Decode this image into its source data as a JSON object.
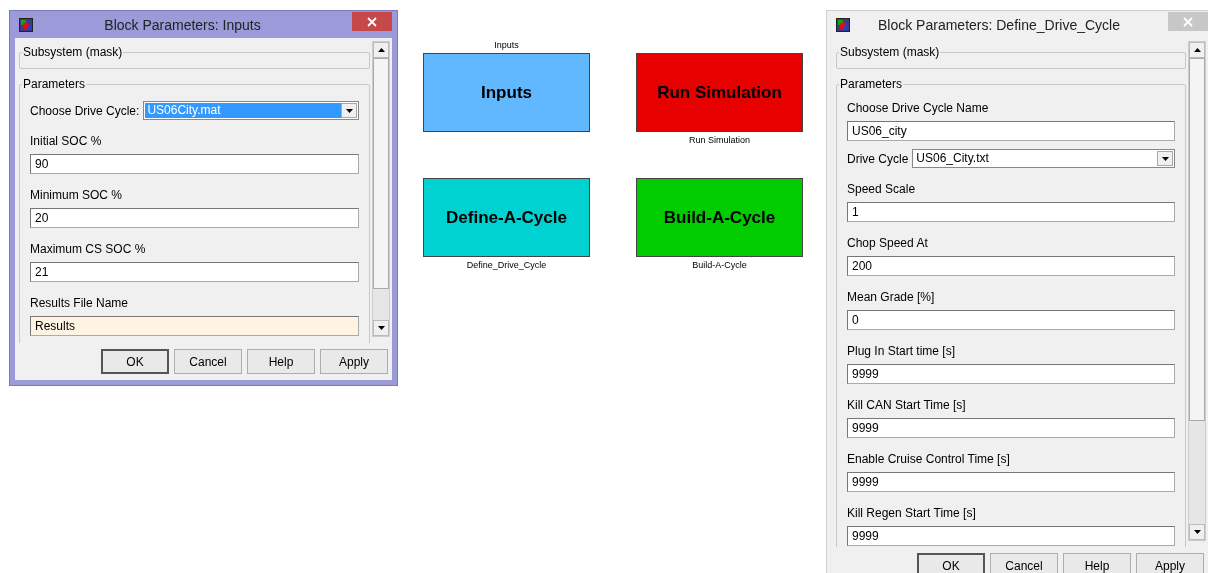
{
  "dialogs": [
    {
      "title": "Block Parameters: Inputs",
      "active": true,
      "group_1": "Subsystem (mask)",
      "group_2": "Parameters",
      "params": [
        {
          "kind": "select-inline",
          "label": "Choose Drive Cycle:",
          "value": "US06City.mat",
          "focused": true
        },
        {
          "kind": "text",
          "label": "Initial SOC %",
          "value": "90",
          "highlighted": false
        },
        {
          "kind": "text",
          "label": "Minimum SOC %",
          "value": "20",
          "highlighted": false
        },
        {
          "kind": "text",
          "label": "Maximum CS SOC %",
          "value": "21",
          "highlighted": false
        },
        {
          "kind": "text",
          "label": "Results File Name",
          "value": "Results",
          "highlighted": true
        }
      ],
      "buttons": [
        {
          "label": "OK",
          "default": true
        },
        {
          "label": "Cancel",
          "default": false
        },
        {
          "label": "Help",
          "default": false
        },
        {
          "label": "Apply",
          "default": false
        }
      ]
    },
    {
      "title": "Block Parameters: Define_Drive_Cycle",
      "active": false,
      "group_1": "Subsystem (mask)",
      "group_2": "Parameters",
      "params": [
        {
          "kind": "text",
          "label": "Choose Drive Cycle Name",
          "value": "US06_city",
          "highlighted": false
        },
        {
          "kind": "select-inline",
          "label": "Drive Cycle",
          "value": "US06_City.txt",
          "focused": false
        },
        {
          "kind": "text",
          "label": "Speed Scale",
          "value": "1",
          "highlighted": false
        },
        {
          "kind": "text",
          "label": "Chop Speed At",
          "value": "200",
          "highlighted": false
        },
        {
          "kind": "text",
          "label": "Mean Grade [%]",
          "value": "0",
          "highlighted": false
        },
        {
          "kind": "text",
          "label": "Plug In Start time [s]",
          "value": "9999",
          "highlighted": false
        },
        {
          "kind": "text",
          "label": "Kill CAN Start Time [s]",
          "value": "9999",
          "highlighted": false
        },
        {
          "kind": "text",
          "label": "Enable Cruise Control Time [s]",
          "value": "9999",
          "highlighted": false
        },
        {
          "kind": "text",
          "label": "Kill Regen Start Time [s]",
          "value": "9999",
          "highlighted": false
        }
      ],
      "buttons": [
        {
          "label": "OK",
          "default": true
        },
        {
          "label": "Cancel",
          "default": false
        },
        {
          "label": "Help",
          "default": false
        },
        {
          "label": "Apply",
          "default": false
        }
      ]
    }
  ],
  "blocks": [
    {
      "caption_above": "Inputs",
      "label": "Inputs",
      "color": "#62b8ff"
    },
    {
      "label": "Run Simulation",
      "caption_below": "Run Simulation",
      "color": "#e60000"
    },
    {
      "label": "Define-A-Cycle",
      "caption_below": "Define_Drive_Cycle",
      "color": "#00d2d2"
    },
    {
      "label": "Build-A-Cycle",
      "caption_below": "Build-A-Cycle",
      "color": "#00cc00"
    }
  ]
}
